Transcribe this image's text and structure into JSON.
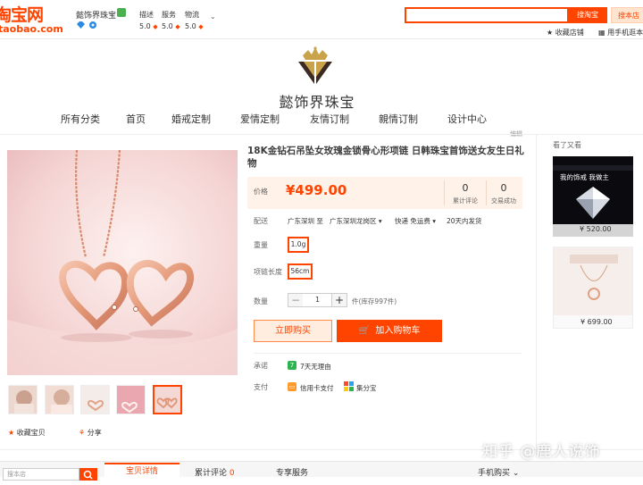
{
  "header": {
    "logo_main": "淘宝网",
    "logo_sub": "taobao.com",
    "shop_name": "懿饰界珠宝",
    "scores": [
      {
        "label": "描述",
        "value": "5.0"
      },
      {
        "label": "服务",
        "value": "5.0"
      },
      {
        "label": "物流",
        "value": "5.0"
      }
    ],
    "search_placeholder": "",
    "search_taobao": "搜淘宝",
    "search_shop": "搜本店",
    "fav_shop": "收藏店铺",
    "mobile_shop": "用手机逛本"
  },
  "banner": {
    "brand_name": "懿饰界珠宝"
  },
  "nav": {
    "items": [
      "所有分类",
      "首页",
      "婚戒定制",
      "爱情定制",
      "友情订制",
      "親情订制",
      "设计中心"
    ],
    "edit": "编辑"
  },
  "product": {
    "title": "18K金钻石吊坠女玫瑰金锁骨心形项链 日韩珠宝首饰送女友生日礼物",
    "price_label": "价格",
    "price": "¥499.00",
    "reviews_count": "0",
    "reviews_label": "累计评论",
    "sales_count": "0",
    "sales_label": "交易成功",
    "shipping_label": "配送",
    "shipping_from": "广东深圳 至",
    "shipping_to": "广东深圳龙岗区",
    "shipping_method": "快递 免运费",
    "shipping_time": "20天内发货",
    "weight_label": "重量",
    "weight_option": "1.0g",
    "length_label": "项链长度",
    "length_option": "56cm",
    "qty_label": "数量",
    "qty_minus": "−",
    "qty_value": "1",
    "qty_plus": "+",
    "stock": "件(库存997件)",
    "buy_now": "立即购买",
    "add_cart": "加入购物车",
    "promise_label": "承诺",
    "promise_text": "7天无理由",
    "pay_label": "支付",
    "pay_credit": "信用卡支付",
    "pay_jifen": "集分宝"
  },
  "gallery": {
    "fav_item": "收藏宝贝",
    "share": "分享"
  },
  "sidebar": {
    "title": "看了又看",
    "card1_line1": "我的饰戒 我做主",
    "card1_price": "¥ 520.00",
    "card2_price": "¥ 699.00"
  },
  "bottom": {
    "search_placeholder": "搜本店",
    "tab_detail": "宝贝详情",
    "tab_reviews": "累计评论",
    "tab_reviews_count": "0",
    "tab_service": "专享服务",
    "mobile_order": "手机购买"
  },
  "watermark": "知乎 @鹿人说饰",
  "colors": {
    "accent": "#ff4400",
    "rose_gold": "#e8a48a"
  }
}
